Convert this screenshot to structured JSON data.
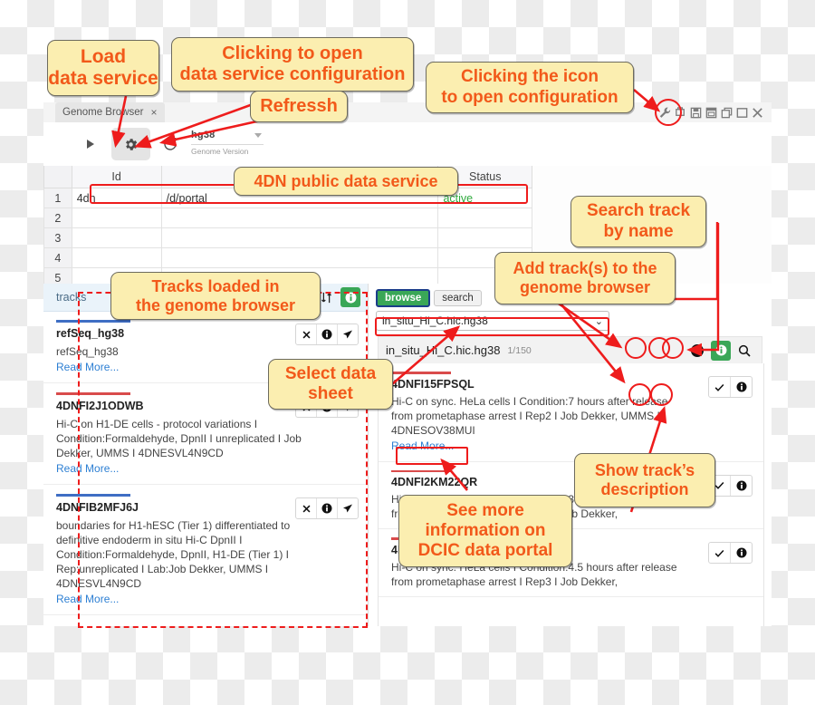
{
  "window": {
    "tab_label": "Genome Browser",
    "tab_close": "×",
    "icons": [
      "wrench-icon",
      "pin-icon",
      "save-icon",
      "copy-icon",
      "restore-icon",
      "maximize-icon",
      "close-icon"
    ]
  },
  "toolbar": {
    "play_label": "▶",
    "gear_label": "⚙",
    "refresh_label": "↻",
    "genome_version_value": "hg38",
    "genome_version_label": "Genome Version"
  },
  "sheet": {
    "columns": [
      "",
      "Id",
      "",
      "Status"
    ],
    "row_numbers": [
      "1",
      "2",
      "3",
      "4",
      "5"
    ],
    "rows": [
      {
        "id": "4dn",
        "path": "/d/portal",
        "status": "active"
      },
      {
        "id": "",
        "path": "",
        "status": ""
      },
      {
        "id": "",
        "path": "",
        "status": ""
      },
      {
        "id": "",
        "path": "",
        "status": ""
      },
      {
        "id": "",
        "path": "",
        "status": ""
      }
    ],
    "status_color": "#2faa3e"
  },
  "tracks_panel": {
    "tab_label": "tracks",
    "sort_icon": "sort-icon",
    "info_icon": "info-icon",
    "items": [
      {
        "name": "refSeq_hg38",
        "description": "refSeq_hg38",
        "read_more": "Read More...",
        "accent": "blue",
        "buttons": [
          "close-icon",
          "info-icon",
          "send-icon"
        ]
      },
      {
        "name": "4DNFI2J1ODWB",
        "description": "Hi-C on H1-DE cells - protocol variations I Condition:Formaldehyde, DpnII I unreplicated I Job Dekker, UMMS I 4DNESVL4N9CD",
        "read_more": "Read More...",
        "accent": "red",
        "buttons": [
          "close-icon",
          "info-icon",
          "send-icon"
        ]
      },
      {
        "name": "4DNFIB2MFJ6J",
        "description": "boundaries for H1-hESC (Tier 1) differentiated to definitive endoderm in situ Hi-C DpnII I Condition:Formaldehyde, DpnII, H1-DE (Tier 1) I Rep:unreplicated I Lab:Job Dekker, UMMS I 4DNESVL4N9CD",
        "read_more": "Read More...",
        "accent": "blue",
        "buttons": [
          "close-icon",
          "info-icon",
          "send-icon"
        ]
      }
    ]
  },
  "browse_panel": {
    "tabs": [
      {
        "label": "browse",
        "active": true
      },
      {
        "label": "search",
        "active": false
      }
    ],
    "datasheet_value": "in_situ_Hi_C.hic.hg38",
    "datasheet_caret": "⌄",
    "result_header": {
      "title": "in_situ_Hi_C.hic.hg38",
      "count": "1/150",
      "buttons": [
        "check-circle-icon",
        "info-icon",
        "search-icon"
      ]
    },
    "results": [
      {
        "name": "4DNFI15FPSQL",
        "description": "Hi-C on sync. HeLa cells I Condition:7 hours after release from prometaphase arrest I Rep2 I Job Dekker, UMMS I 4DNESOV38MUI",
        "read_more": "Read More...",
        "buttons": [
          "check-icon",
          "info-icon"
        ]
      },
      {
        "name": "4DNFI2KM22QR",
        "description": "Hi-C on sync. HeLa cells I Condition:3.5 hours after release from prometaphase arrest I Rep3 I Job Dekker,",
        "read_more": "",
        "buttons": [
          "check-icon",
          "info-icon"
        ]
      },
      {
        "name": "4DNFI2RN3WFP",
        "description": "Hi-C on sync. HeLa cells I Condition:4.5 hours after release from prometaphase arrest I Rep3 I Job Dekker,",
        "read_more": "",
        "buttons": [
          "check-icon",
          "info-icon"
        ]
      }
    ]
  },
  "annotations": {
    "accent_color": "#f2591a",
    "callout_bg": "#fbeeb0",
    "marker_color": "#ee1c1c",
    "callouts": [
      {
        "id": "load-data-service",
        "text": "Load\ndata service"
      },
      {
        "id": "clicking-to-open-config",
        "text": "Clicking to open\ndata service configuration"
      },
      {
        "id": "refresh",
        "text": "Refressh"
      },
      {
        "id": "clicking-the-icon",
        "text": "Clicking the icon\nto open configuration"
      },
      {
        "id": "4dn-public-data-service",
        "text": "4DN public data service"
      },
      {
        "id": "search-track-by-name",
        "text": "Search track\nby name"
      },
      {
        "id": "add-tracks",
        "text": "Add track(s) to the\ngenome browser"
      },
      {
        "id": "tracks-loaded",
        "text": "Tracks loaded in\nthe genome browser"
      },
      {
        "id": "select-data-sheet",
        "text": "Select data\nsheet"
      },
      {
        "id": "show-track-description",
        "text": "Show track’s\ndescription"
      },
      {
        "id": "see-more-info",
        "text": "See more\ninformation on\nDCIC data portal"
      }
    ]
  }
}
